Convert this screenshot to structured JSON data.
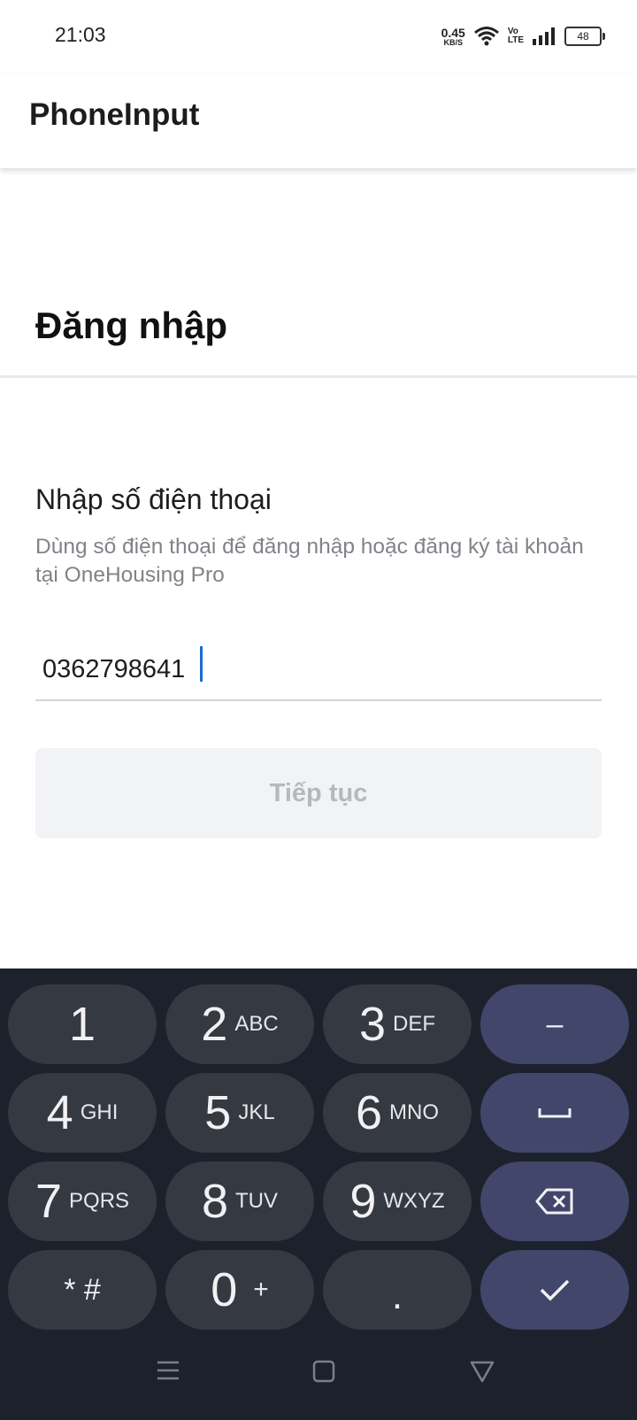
{
  "status_bar": {
    "time": "21:03",
    "net_speed_value": "0.45",
    "net_speed_unit": "KB/S",
    "volte_top": "Vo",
    "volte_bottom": "LTE",
    "battery": "48"
  },
  "app_bar": {
    "title": "PhoneInput"
  },
  "page": {
    "heading": "Đăng nhập",
    "section_label": "Nhập số điện thoại",
    "section_description": "Dùng số điện thoại để đăng nhập hoặc đăng ký tài khoản tại OneHousing Pro",
    "phone_value": "0362798641",
    "continue_label": "Tiếp tục"
  },
  "keyboard": {
    "key_1": {
      "num": "1",
      "letters": ""
    },
    "key_2": {
      "num": "2",
      "letters": "ABC"
    },
    "key_3": {
      "num": "3",
      "letters": "DEF"
    },
    "key_4": {
      "num": "4",
      "letters": "GHI"
    },
    "key_5": {
      "num": "5",
      "letters": "JKL"
    },
    "key_6": {
      "num": "6",
      "letters": "MNO"
    },
    "key_7": {
      "num": "7",
      "letters": "PQRS"
    },
    "key_8": {
      "num": "8",
      "letters": "TUV"
    },
    "key_9": {
      "num": "9",
      "letters": "WXYZ"
    },
    "key_0": {
      "num": "0",
      "letters": "+"
    },
    "key_star_hash": "* #",
    "key_dot": ".",
    "key_minus": "–",
    "icons": {
      "space": "space-icon",
      "backspace": "backspace-icon",
      "done": "checkmark-icon"
    }
  },
  "nav_bar": {
    "icons": [
      "menu-icon",
      "home-square-icon",
      "back-triangle-icon"
    ]
  },
  "colors": {
    "keyboard_bg": "#1d212c",
    "key_bg": "#353942",
    "action_key_bg": "#41466a",
    "cursor": "#1e6bd6"
  }
}
